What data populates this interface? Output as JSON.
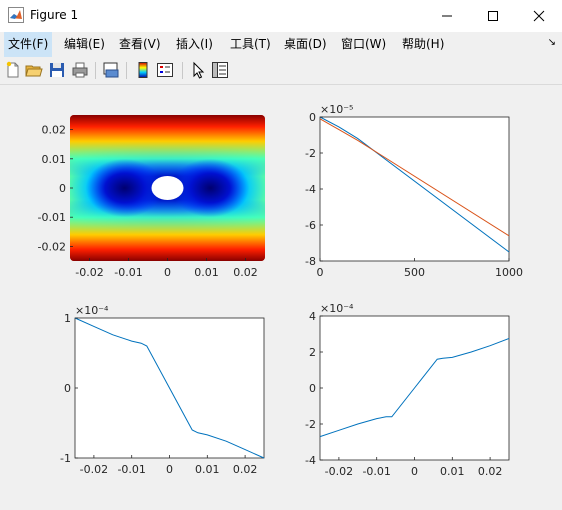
{
  "window": {
    "title": "Figure 1",
    "icon": "matlab-icon"
  },
  "menu": [
    {
      "label": "文件(F)"
    },
    {
      "label": "编辑(E)"
    },
    {
      "label": "查看(V)"
    },
    {
      "label": "插入(I)"
    },
    {
      "label": "工具(T)"
    },
    {
      "label": "桌面(D)"
    },
    {
      "label": "窗口(W)"
    },
    {
      "label": "帮助(H)"
    }
  ],
  "toolbar_icons": [
    "new-figure-icon",
    "open-file-icon",
    "save-icon",
    "print-icon",
    "link-plot-icon",
    "insert-colorbar-icon",
    "insert-legend-icon",
    "pointer-icon",
    "property-inspector-icon"
  ],
  "chart_data": [
    {
      "type": "heatmap",
      "description_tick_labels_only": true,
      "xticks": [
        "-0.02",
        "-0.01",
        "0",
        "0.01",
        "0.02"
      ],
      "yticks": [
        "0.02",
        "0.01",
        "0",
        "-0.01",
        "-0.02"
      ],
      "xlim": [
        -0.025,
        0.025
      ],
      "ylim": [
        -0.025,
        0.025
      ],
      "colormap": "jet"
    },
    {
      "type": "line",
      "exponent": "×10⁻⁵",
      "xticks": [
        "0",
        "500",
        "1000"
      ],
      "yticks": [
        "0",
        "-2",
        "-4",
        "-6",
        "-8"
      ],
      "xlim": [
        0,
        1000
      ],
      "ylim": [
        -8,
        0
      ],
      "series": [
        {
          "color": "#0072bd",
          "x": [
            0,
            100,
            200,
            1000
          ],
          "y": [
            0,
            -0.55,
            -1.2,
            -7.5
          ]
        },
        {
          "color": "#d95319",
          "x": [
            0,
            100,
            200,
            1000
          ],
          "y": [
            -0.1,
            -0.7,
            -1.3,
            -6.6
          ]
        }
      ]
    },
    {
      "type": "line",
      "exponent": "×10⁻⁴",
      "xticks": [
        "-0.02",
        "-0.01",
        "0",
        "0.01",
        "0.02"
      ],
      "yticks": [
        "1",
        "0",
        "-1"
      ],
      "xlim": [
        -0.025,
        0.025
      ],
      "ylim": [
        -1,
        1
      ],
      "series": [
        {
          "color": "#0072bd",
          "x": [
            -0.025,
            -0.02,
            -0.015,
            -0.01,
            -0.0075,
            -0.006,
            0,
            0.006,
            0.0075,
            0.01,
            0.015,
            0.02,
            0.025
          ],
          "y": [
            1.0,
            0.88,
            0.76,
            0.67,
            0.64,
            0.6,
            0.0,
            -0.6,
            -0.64,
            -0.67,
            -0.76,
            -0.88,
            -1.0
          ]
        }
      ]
    },
    {
      "type": "line",
      "exponent": "×10⁻⁴",
      "xticks": [
        "-0.02",
        "-0.01",
        "0",
        "0.01",
        "0.02"
      ],
      "yticks": [
        "4",
        "2",
        "0",
        "-2",
        "-4"
      ],
      "xlim": [
        -0.025,
        0.025
      ],
      "ylim": [
        -4,
        4
      ],
      "series": [
        {
          "color": "#0072bd",
          "x": [
            -0.025,
            -0.02,
            -0.015,
            -0.01,
            -0.0075,
            -0.006,
            0,
            0.006,
            0.0075,
            0.01,
            0.015,
            0.02,
            0.025
          ],
          "y": [
            -2.7,
            -2.35,
            -2.0,
            -1.7,
            -1.6,
            -1.6,
            0.0,
            1.6,
            1.65,
            1.7,
            2.0,
            2.35,
            2.75
          ]
        }
      ]
    }
  ]
}
